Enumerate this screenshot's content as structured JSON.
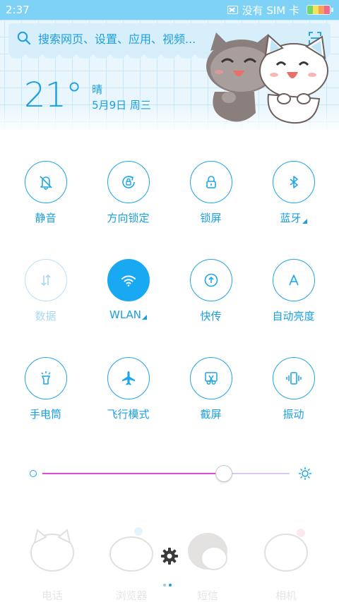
{
  "status_bar": {
    "time": "2:37",
    "sim_text": "没有 SIM 卡"
  },
  "search": {
    "placeholder": "搜索网页、设置、应用、视频..."
  },
  "weather": {
    "temperature": "21°",
    "condition": "晴",
    "date": "5月9日 周三"
  },
  "toggles": [
    {
      "id": "mute",
      "label": "静音",
      "icon": "bell-off-icon",
      "state": "off",
      "expandable": false
    },
    {
      "id": "rotation-lock",
      "label": "方向锁定",
      "icon": "rotation-lock-icon",
      "state": "off",
      "expandable": false
    },
    {
      "id": "lock-screen",
      "label": "锁屏",
      "icon": "lock-icon",
      "state": "off",
      "expandable": false
    },
    {
      "id": "bluetooth",
      "label": "蓝牙",
      "icon": "bluetooth-icon",
      "state": "off",
      "expandable": true
    },
    {
      "id": "mobile-data",
      "label": "数据",
      "icon": "data-arrows-icon",
      "state": "disabled",
      "expandable": false
    },
    {
      "id": "wlan",
      "label": "WLAN",
      "icon": "wifi-icon",
      "state": "on",
      "expandable": true
    },
    {
      "id": "quick-transfer",
      "label": "快传",
      "icon": "upload-circle-icon",
      "state": "off",
      "expandable": false
    },
    {
      "id": "auto-brightness",
      "label": "自动亮度",
      "icon": "letter-a-icon",
      "state": "off",
      "expandable": false
    },
    {
      "id": "flashlight",
      "label": "手电筒",
      "icon": "flashlight-icon",
      "state": "off",
      "expandable": false
    },
    {
      "id": "airplane-mode",
      "label": "飞行模式",
      "icon": "airplane-icon",
      "state": "off",
      "expandable": false
    },
    {
      "id": "screenshot",
      "label": "截屏",
      "icon": "scissors-icon",
      "state": "off",
      "expandable": false
    },
    {
      "id": "vibrate",
      "label": "振动",
      "icon": "vibrate-icon",
      "state": "off",
      "expandable": false
    }
  ],
  "brightness": {
    "level": 0.735
  },
  "dock": [
    {
      "label": "电话",
      "icon": "cat-phone-icon"
    },
    {
      "label": "浏览器",
      "icon": "cat-browser-icon"
    },
    {
      "label": "短信",
      "icon": "cat-message-icon"
    },
    {
      "label": "相机",
      "icon": "cat-camera-icon"
    }
  ],
  "colors": {
    "accent": "#1a9fe0",
    "active_toggle": "#19a9f3",
    "status_bar": "#7ed2f6",
    "slider_fill": "#e04ad2",
    "slider_track": "#d9c9ef"
  }
}
